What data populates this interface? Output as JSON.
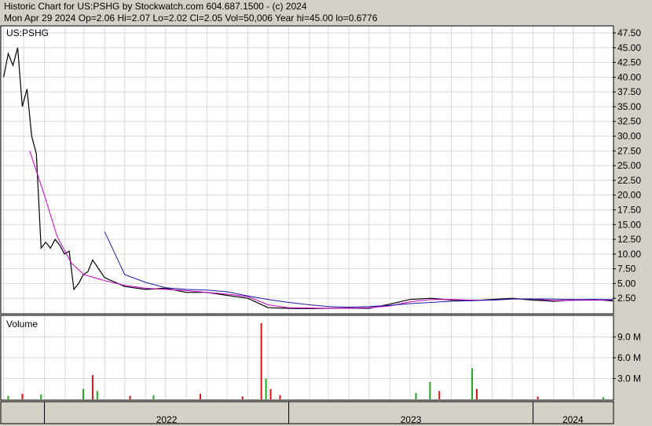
{
  "header": {
    "line1": "Historic Chart for US:PSHG by Stockwatch.com 604.687.1500 - (c) 2024",
    "line2": "Mon Apr 29 2024  Op=2.06  Hi=2.07  Lo=2.02  Cl=2.05  Vol=50,006  Year hi=45.00  lo=0.6776"
  },
  "colors": {
    "background": "#d4d0c8",
    "panel": "#ffffff",
    "grid": "#d8d8d8",
    "price": "#000000",
    "ma_short": "#cc00cc",
    "ma_long": "#1a1aa6",
    "volume_up": "#22aa22",
    "volume_down": "#dd1111"
  },
  "chart_data": [
    {
      "type": "line",
      "panel": "price",
      "symbol_label": "US:PSHG",
      "ylim": [
        0,
        47.5
      ],
      "y_ticks": [
        "47.50",
        "45.00",
        "42.50",
        "40.00",
        "37.50",
        "35.00",
        "32.50",
        "30.00",
        "27.50",
        "25.00",
        "22.50",
        "20.00",
        "17.50",
        "15.00",
        "12.50",
        "10.00",
        "7.50",
        "5.00",
        "2.50"
      ],
      "x_labels": [
        "2022",
        "2023",
        "2024"
      ],
      "series": [
        {
          "key": "price",
          "x": [
            "2021-11-01",
            "2021-11-08",
            "2021-11-15",
            "2021-11-22",
            "2021-11-29",
            "2021-12-06",
            "2021-12-13",
            "2021-12-20",
            "2021-12-27",
            "2022-01-03",
            "2022-01-10",
            "2022-01-17",
            "2022-01-24",
            "2022-01-31",
            "2022-02-07",
            "2022-02-14",
            "2022-02-21",
            "2022-02-28",
            "2022-03-07",
            "2022-03-14",
            "2022-04-01",
            "2022-05-01",
            "2022-06-01",
            "2022-07-01",
            "2022-08-01",
            "2022-09-01",
            "2022-10-01",
            "2022-11-01",
            "2022-12-01",
            "2023-01-01",
            "2023-02-01",
            "2023-03-01",
            "2023-04-01",
            "2023-05-01",
            "2023-06-01",
            "2023-07-01",
            "2023-08-01",
            "2023-09-01",
            "2023-10-01",
            "2023-11-01",
            "2023-12-01",
            "2024-01-01",
            "2024-02-01",
            "2024-03-01",
            "2024-04-01",
            "2024-04-29"
          ],
          "values": [
            40,
            44,
            42,
            45,
            35,
            38,
            30,
            27,
            11,
            12,
            11,
            12.5,
            11.5,
            10,
            10.5,
            4,
            5,
            6.5,
            7,
            9,
            6,
            4.5,
            4,
            4.2,
            3.5,
            3.5,
            3,
            2.5,
            0.9,
            0.8,
            0.75,
            0.8,
            0.85,
            0.8,
            1.5,
            2.3,
            2.5,
            2.2,
            2.1,
            2.3,
            2.5,
            2.2,
            2.0,
            2.2,
            2.3,
            2.05
          ]
        },
        {
          "key": "ma_short",
          "x": [
            "2021-12-10",
            "2022-01-01",
            "2022-01-20",
            "2022-02-10",
            "2022-03-01",
            "2022-04-01",
            "2022-05-01",
            "2022-06-01",
            "2022-07-01",
            "2022-08-01",
            "2022-09-01",
            "2022-10-01",
            "2022-11-01",
            "2022-12-01",
            "2023-01-01",
            "2023-02-01",
            "2023-03-01",
            "2023-04-01",
            "2023-05-01",
            "2023-06-01",
            "2023-07-01",
            "2023-08-01",
            "2023-09-01",
            "2023-10-01",
            "2023-11-01",
            "2023-12-01",
            "2024-01-01",
            "2024-02-01",
            "2024-03-01",
            "2024-04-29"
          ],
          "values": [
            27.5,
            20,
            13,
            8.5,
            6.5,
            5.5,
            4.7,
            4.2,
            4.0,
            3.8,
            3.5,
            3.2,
            2.8,
            1.4,
            0.9,
            0.85,
            0.8,
            0.85,
            0.9,
            1.2,
            1.9,
            2.3,
            2.3,
            2.2,
            2.2,
            2.4,
            2.4,
            2.1,
            2.15,
            2.2
          ]
        },
        {
          "key": "ma_long",
          "x": [
            "2022-04-01",
            "2022-05-01",
            "2022-06-01",
            "2022-07-01",
            "2022-08-01",
            "2022-09-01",
            "2022-10-01",
            "2022-11-01",
            "2022-12-01",
            "2023-01-01",
            "2023-02-01",
            "2023-03-01",
            "2023-04-01",
            "2023-05-01",
            "2023-06-01",
            "2023-07-01",
            "2023-08-01",
            "2023-09-01",
            "2023-10-01",
            "2023-11-01",
            "2023-12-01",
            "2024-01-01",
            "2024-02-01",
            "2024-03-01",
            "2024-04-29"
          ],
          "values": [
            13.8,
            6.5,
            5.2,
            4.3,
            4.0,
            3.9,
            3.6,
            2.9,
            2.3,
            1.8,
            1.4,
            1.1,
            1.0,
            1.1,
            1.3,
            1.6,
            1.8,
            2.0,
            2.1,
            2.2,
            2.35,
            2.4,
            2.35,
            2.3,
            2.3
          ]
        }
      ]
    },
    {
      "type": "bar",
      "panel": "volume",
      "title": "Volume",
      "ylim": [
        0,
        12000000
      ],
      "y_ticks": [
        "9.0 M",
        "6.0 M",
        "3.0 M"
      ],
      "x": [
        "2021-11-08",
        "2021-11-29",
        "2021-12-27",
        "2022-02-28",
        "2022-03-14",
        "2022-03-21",
        "2022-05-09",
        "2022-06-13",
        "2022-08-22",
        "2022-10-24",
        "2022-11-21",
        "2022-11-28",
        "2022-12-05",
        "2022-12-19",
        "2023-07-10",
        "2023-07-31",
        "2023-08-14",
        "2023-10-02",
        "2023-10-09",
        "2024-01-08",
        "2024-04-15"
      ],
      "values": [
        500000,
        800000,
        700000,
        1500000,
        3500000,
        1200000,
        500000,
        600000,
        800000,
        400000,
        11000000,
        3000000,
        1500000,
        600000,
        900000,
        2500000,
        1200000,
        4500000,
        1500000,
        400000,
        300000
      ],
      "up": [
        true,
        false,
        true,
        true,
        false,
        true,
        false,
        true,
        false,
        false,
        false,
        true,
        false,
        false,
        true,
        true,
        false,
        true,
        false,
        false,
        true
      ]
    }
  ]
}
